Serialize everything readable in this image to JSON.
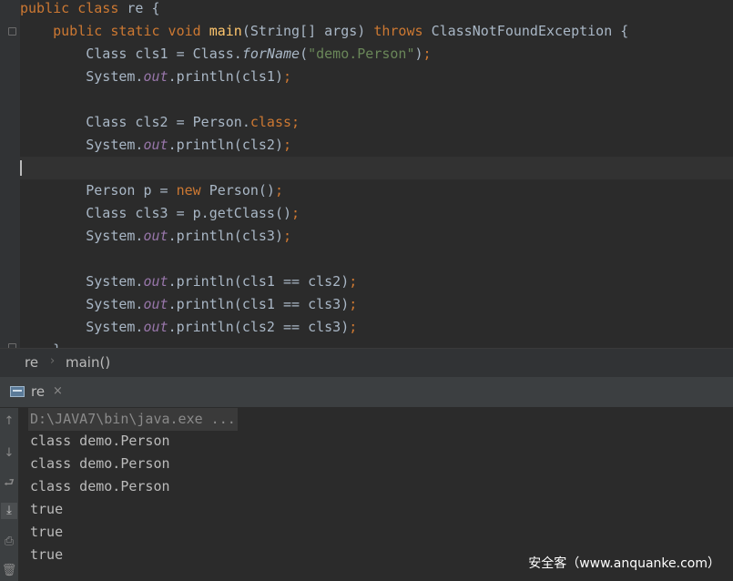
{
  "editor": {
    "lines": [
      [
        {
          "t": "public class ",
          "c": "kw"
        },
        {
          "t": "re {"
        }
      ],
      [
        {
          "t": "    "
        },
        {
          "t": "public static void ",
          "c": "kw"
        },
        {
          "t": "main",
          "c": "fn"
        },
        {
          "t": "(String[] args) "
        },
        {
          "t": "throws ",
          "c": "kw"
        },
        {
          "t": "ClassNotFoundException {"
        }
      ],
      [
        {
          "t": "        Class cls1 = Class."
        },
        {
          "t": "forName",
          "c": "itw"
        },
        {
          "t": "("
        },
        {
          "t": "\"demo.Person\"",
          "c": "str"
        },
        {
          "t": ")"
        },
        {
          "t": ";",
          "c": "kw"
        }
      ],
      [
        {
          "t": "        System."
        },
        {
          "t": "out",
          "c": "it"
        },
        {
          "t": ".println(cls1)"
        },
        {
          "t": ";",
          "c": "kw"
        }
      ],
      [],
      [
        {
          "t": "        Class cls2 = Person."
        },
        {
          "t": "class",
          "c": "kw"
        },
        {
          "t": ";",
          "c": "kw"
        }
      ],
      [
        {
          "t": "        System."
        },
        {
          "t": "out",
          "c": "it"
        },
        {
          "t": ".println(cls2)"
        },
        {
          "t": ";",
          "c": "kw"
        }
      ],
      [],
      [
        {
          "t": "        Person p = "
        },
        {
          "t": "new ",
          "c": "kw"
        },
        {
          "t": "Person()"
        },
        {
          "t": ";",
          "c": "kw"
        }
      ],
      [
        {
          "t": "        Class cls3 = p.getClass()"
        },
        {
          "t": ";",
          "c": "kw"
        }
      ],
      [
        {
          "t": "        System."
        },
        {
          "t": "out",
          "c": "it"
        },
        {
          "t": ".println(cls3)"
        },
        {
          "t": ";",
          "c": "kw"
        }
      ],
      [],
      [
        {
          "t": "        System."
        },
        {
          "t": "out",
          "c": "it"
        },
        {
          "t": ".println(cls1 == cls2)"
        },
        {
          "t": ";",
          "c": "kw"
        }
      ],
      [
        {
          "t": "        System."
        },
        {
          "t": "out",
          "c": "it"
        },
        {
          "t": ".println(cls1 == cls3)"
        },
        {
          "t": ";",
          "c": "kw"
        }
      ],
      [
        {
          "t": "        System."
        },
        {
          "t": "out",
          "c": "it"
        },
        {
          "t": ".println(cls2 == cls3)"
        },
        {
          "t": ";",
          "c": "kw"
        }
      ],
      [
        {
          "t": "    }"
        }
      ]
    ]
  },
  "breadcrumb": {
    "class_name": "re",
    "separator": "›",
    "method_name": "main()"
  },
  "run_panel": {
    "tab_label": "re",
    "close_glyph": "×"
  },
  "console": {
    "command": "D:\\JAVA7\\bin\\java.exe ...",
    "output": [
      "class demo.Person",
      "class demo.Person",
      "class demo.Person",
      "true",
      "true",
      "true"
    ]
  },
  "tools": [
    {
      "name": "rerun-up-icon",
      "glyph": "↑"
    },
    {
      "name": "scroll-down-icon",
      "glyph": "↓"
    },
    {
      "name": "soft-wrap-icon",
      "glyph": "⮐"
    },
    {
      "name": "scroll-to-end-icon",
      "glyph": "⤓"
    },
    {
      "name": "print-icon",
      "glyph": "⎙"
    },
    {
      "name": "trash-icon",
      "glyph": "🗑"
    }
  ],
  "watermark": "安全客（www.anquanke.com）"
}
